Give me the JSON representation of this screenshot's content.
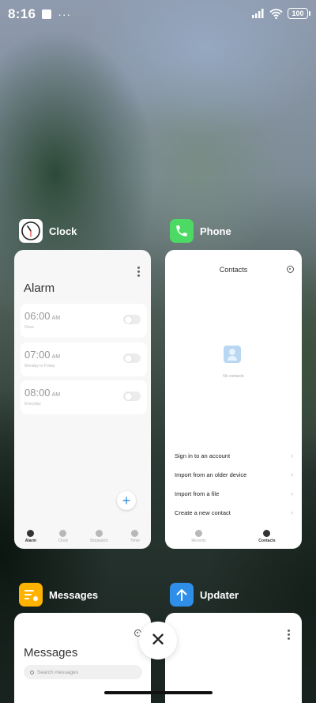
{
  "status_bar": {
    "time": "8:16",
    "notif_dots": "···",
    "battery": "100"
  },
  "apps": {
    "clock": {
      "name": "Clock",
      "screen_title": "Alarm",
      "alarms": [
        {
          "time": "06:00",
          "ampm": "AM",
          "label": "Once"
        },
        {
          "time": "07:00",
          "ampm": "AM",
          "label": "Monday to Friday"
        },
        {
          "time": "08:00",
          "ampm": "AM",
          "label": "Everyday"
        }
      ],
      "add_label": "+",
      "nav": [
        {
          "label": "Alarm",
          "active": true
        },
        {
          "label": "Clock",
          "active": false
        },
        {
          "label": "Stopwatch",
          "active": false
        },
        {
          "label": "Timer",
          "active": false
        }
      ]
    },
    "phone": {
      "name": "Phone",
      "screen_title": "Contacts",
      "empty_text": "No contacts",
      "options": [
        "Sign in to an account",
        "Import from an older device",
        "Import from a file",
        "Create a new contact"
      ],
      "nav": [
        {
          "label": "Recents",
          "active": false
        },
        {
          "label": "Contacts",
          "active": true
        }
      ]
    },
    "messages": {
      "name": "Messages",
      "screen_title": "Messages",
      "search_placeholder": "Search messages"
    },
    "updater": {
      "name": "Updater"
    }
  },
  "close_label": "✕",
  "colors": {
    "clock_icon": "#ffffff",
    "phone_icon": "#4cd964",
    "messages_icon": "#ffb300",
    "updater_icon": "#2f8fe8",
    "fab_accent": "#2c8de0"
  }
}
